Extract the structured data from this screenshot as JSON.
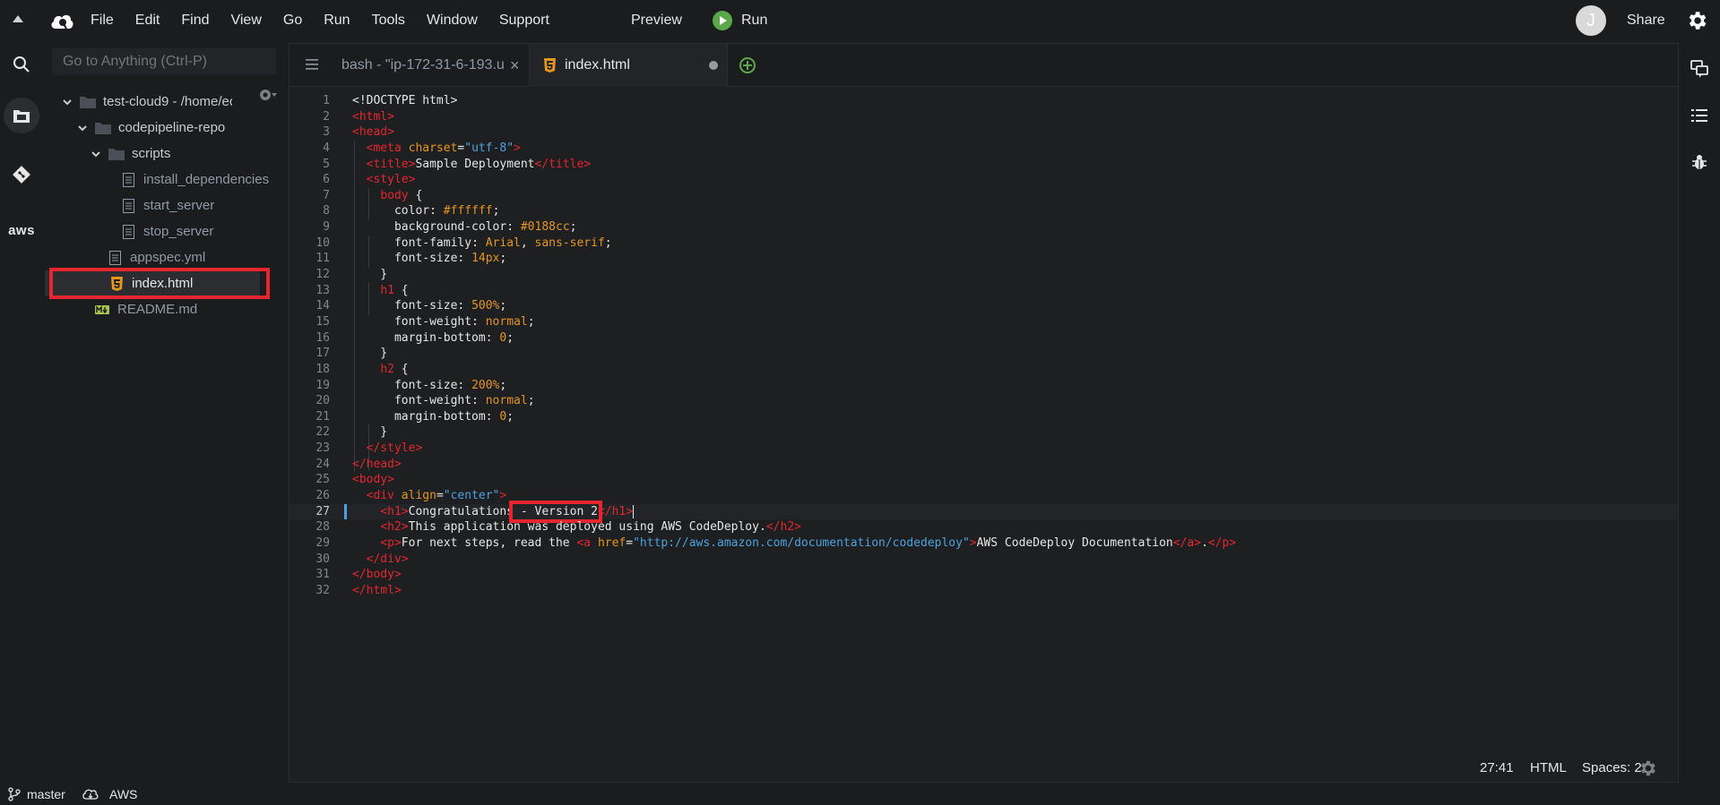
{
  "menubar": {
    "items": [
      "File",
      "Edit",
      "Find",
      "View",
      "Go",
      "Run",
      "Tools",
      "Window",
      "Support"
    ],
    "preview_label": "Preview",
    "run_label": "Run",
    "avatar_letter": "J",
    "share_label": "Share"
  },
  "search": {
    "placeholder": "Go to Anything (Ctrl-P)"
  },
  "filetree": {
    "root": "test-cloud9 - /home/ec",
    "repo": "codepipeline-repo",
    "scripts_folder": "scripts",
    "scripts": [
      "install_dependencies",
      "start_server",
      "stop_server"
    ],
    "appspec": "appspec.yml",
    "index": "index.html",
    "readme": "README.md"
  },
  "leftrail": {
    "aws_label": "aws"
  },
  "tabs": {
    "bash_label": "bash - \"ip-172-31-6-193.u",
    "bash_close": "×",
    "index_label": "index.html"
  },
  "editor": {
    "lines": [
      "1",
      "2",
      "3",
      "4",
      "5",
      "6",
      "7",
      "8",
      "9",
      "10",
      "11",
      "12",
      "13",
      "14",
      "15",
      "16",
      "17",
      "18",
      "19",
      "20",
      "21",
      "22",
      "23",
      "24",
      "25",
      "26",
      "27",
      "28",
      "29",
      "30",
      "31",
      "32"
    ],
    "code": {
      "l1": "<!DOCTYPE html>",
      "l4_tag_open": "<meta",
      "l4_attr": "charset",
      "l4_str": "\"utf-8\"",
      "l5_title_text": "Sample Deployment",
      "l7_sel": "body",
      "l8_prop": "color",
      "l8_val": "#ffffff",
      "l9_prop": "background-color",
      "l9_val": "#0188cc",
      "l10_prop": "font-family",
      "l10_val1": "Arial",
      "l10_val2": "sans-serif",
      "l11_prop": "font-size",
      "l11_val": "14px",
      "l13_sel": "h1",
      "l14_val": "500%",
      "l15_prop": "font-weight",
      "l15_val": "normal",
      "l16_prop": "margin-bottom",
      "l16_val": "0",
      "l18_sel": "h2",
      "l19_val": "200%",
      "l26_attr": "align",
      "l26_str": "\"center\"",
      "l27_text": "Congratulations",
      "l27_highlight": " - Version 2",
      "l28_text": "This application was deployed using AWS CodeDeploy.",
      "l29_text1": "For next steps, read the ",
      "l29_attr": "href",
      "l29_str": "\"http://aws.amazon.com/documentation/codedeploy\"",
      "l29_link": "AWS CodeDeploy Documentation"
    }
  },
  "status": {
    "position": "27:41",
    "language": "HTML",
    "spaces": "Spaces: 2"
  },
  "bottombar": {
    "branch": "master",
    "region": "AWS"
  },
  "colors": {
    "accent_red": "#e5262f",
    "run_green": "#5ba84a",
    "tag_red": "#e5262f",
    "attr_orange": "#e6951f",
    "string_blue": "#4aa3df"
  }
}
